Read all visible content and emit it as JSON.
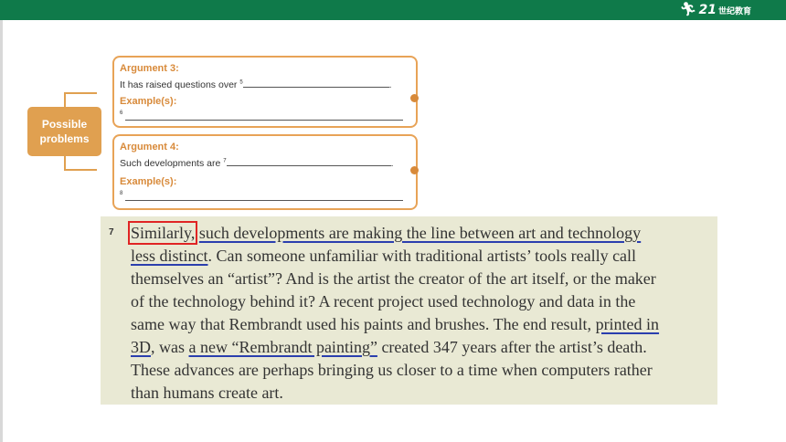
{
  "brand": {
    "number": "21",
    "name": "世纪教育"
  },
  "diagram": {
    "main_label_line1": "Possible",
    "main_label_line2": "problems",
    "arguments": [
      {
        "title": "Argument 3:",
        "statement": "It has raised questions over",
        "statement_ref": "5",
        "examples_label": "Example(s):",
        "examples_ref": "6"
      },
      {
        "title": "Argument 4:",
        "statement": "Such developments are",
        "statement_ref": "7",
        "examples_label": "Example(s):",
        "examples_ref": "8"
      }
    ]
  },
  "passage": {
    "number": "7",
    "lines": [
      [
        {
          "text": "Similarly,",
          "style": "boxed"
        },
        {
          "text": " ",
          "style": ""
        },
        {
          "text": "such developments are making the line between art and technology",
          "style": "underline"
        }
      ],
      [
        {
          "text": "less distinct",
          "style": "underline"
        },
        {
          "text": ". Can someone unfamiliar with traditional artists’ tools really call",
          "style": ""
        }
      ],
      [
        {
          "text": "themselves an “artist”? And is the artist the creator of the art itself, or the maker",
          "style": ""
        }
      ],
      [
        {
          "text": "of the technology behind it? A recent project used technology and data in the",
          "style": ""
        }
      ],
      [
        {
          "text": "same way that Rembrandt used his paints and brushes. The end result, ",
          "style": ""
        },
        {
          "text": "printed in",
          "style": "underline"
        }
      ],
      [
        {
          "text": "3D",
          "style": "underline"
        },
        {
          "text": ", was ",
          "style": ""
        },
        {
          "text": "a new “Rembrandt painting”",
          "style": "underline"
        },
        {
          "text": " created 347 years after the artist’s death.",
          "style": ""
        }
      ],
      [
        {
          "text": "These advances are perhaps bringing us closer to a time when computers rather",
          "style": ""
        }
      ],
      [
        {
          "text": "than humans create art.",
          "style": ""
        }
      ]
    ]
  }
}
